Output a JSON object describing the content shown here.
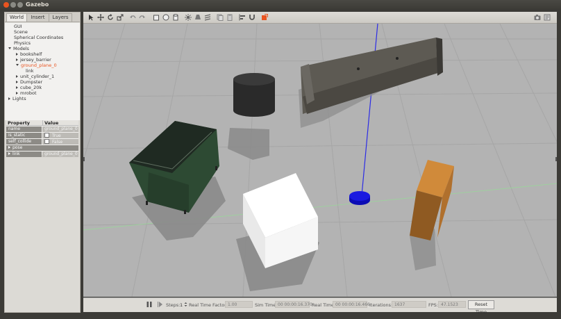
{
  "window": {
    "title": "Gazebo"
  },
  "tabs": [
    "World",
    "Insert",
    "Layers"
  ],
  "tree": {
    "gui": "GUI",
    "scene": "Scene",
    "spherical": "Spherical Coordinates",
    "physics": "Physics",
    "models": "Models",
    "bookshelf": "bookshelf",
    "jersey_barrier": "jersey_barrier",
    "ground_plane": "ground_plane_0",
    "link": "link",
    "unit_cylinder": "unit_cylinder_1",
    "dumpster": "Dumpster",
    "cube": "cube_20k",
    "mrobot": "mrobot",
    "lights": "Lights"
  },
  "properties": {
    "header_property": "Property",
    "header_value": "Value",
    "name_key": "name",
    "name_value": "ground_plane_0",
    "static_key": "is_static",
    "static_value": "True",
    "collide_key": "self_collide",
    "collide_value": "False",
    "pose_key": "pose",
    "link_key": "link",
    "link_value": "ground_plane_0"
  },
  "toolbar_icons": [
    "select-arrow-icon",
    "translate-icon",
    "rotate-icon",
    "scale-icon",
    "undo-icon",
    "redo-icon",
    "box-icon",
    "sphere-icon",
    "cylinder-icon",
    "point-light-icon",
    "spot-light-icon",
    "directional-light-icon",
    "copy-icon",
    "paste-icon",
    "align-icon",
    "snap-icon",
    "change-view-icon",
    "screenshot-icon",
    "log-icon"
  ],
  "bottom": {
    "steps_label": "Steps:",
    "steps_value": "1",
    "rtf_label": "Real Time Factor:",
    "rtf_value": "1.00",
    "sim_label": "Sim Time:",
    "sim_value": "00 00:00:16.370",
    "real_label": "Real Time:",
    "real_value": "00 00:00:16.466",
    "iter_label": "Iterations:",
    "iter_value": "1637",
    "fps_label": "FPS:",
    "fps_value": "47.1523",
    "reset_label": "Reset Time"
  },
  "colors": {
    "accent": "#e95420",
    "ground": "#b2b2b2",
    "robot": "#1a1ae0",
    "axis": "#2b2be6"
  }
}
